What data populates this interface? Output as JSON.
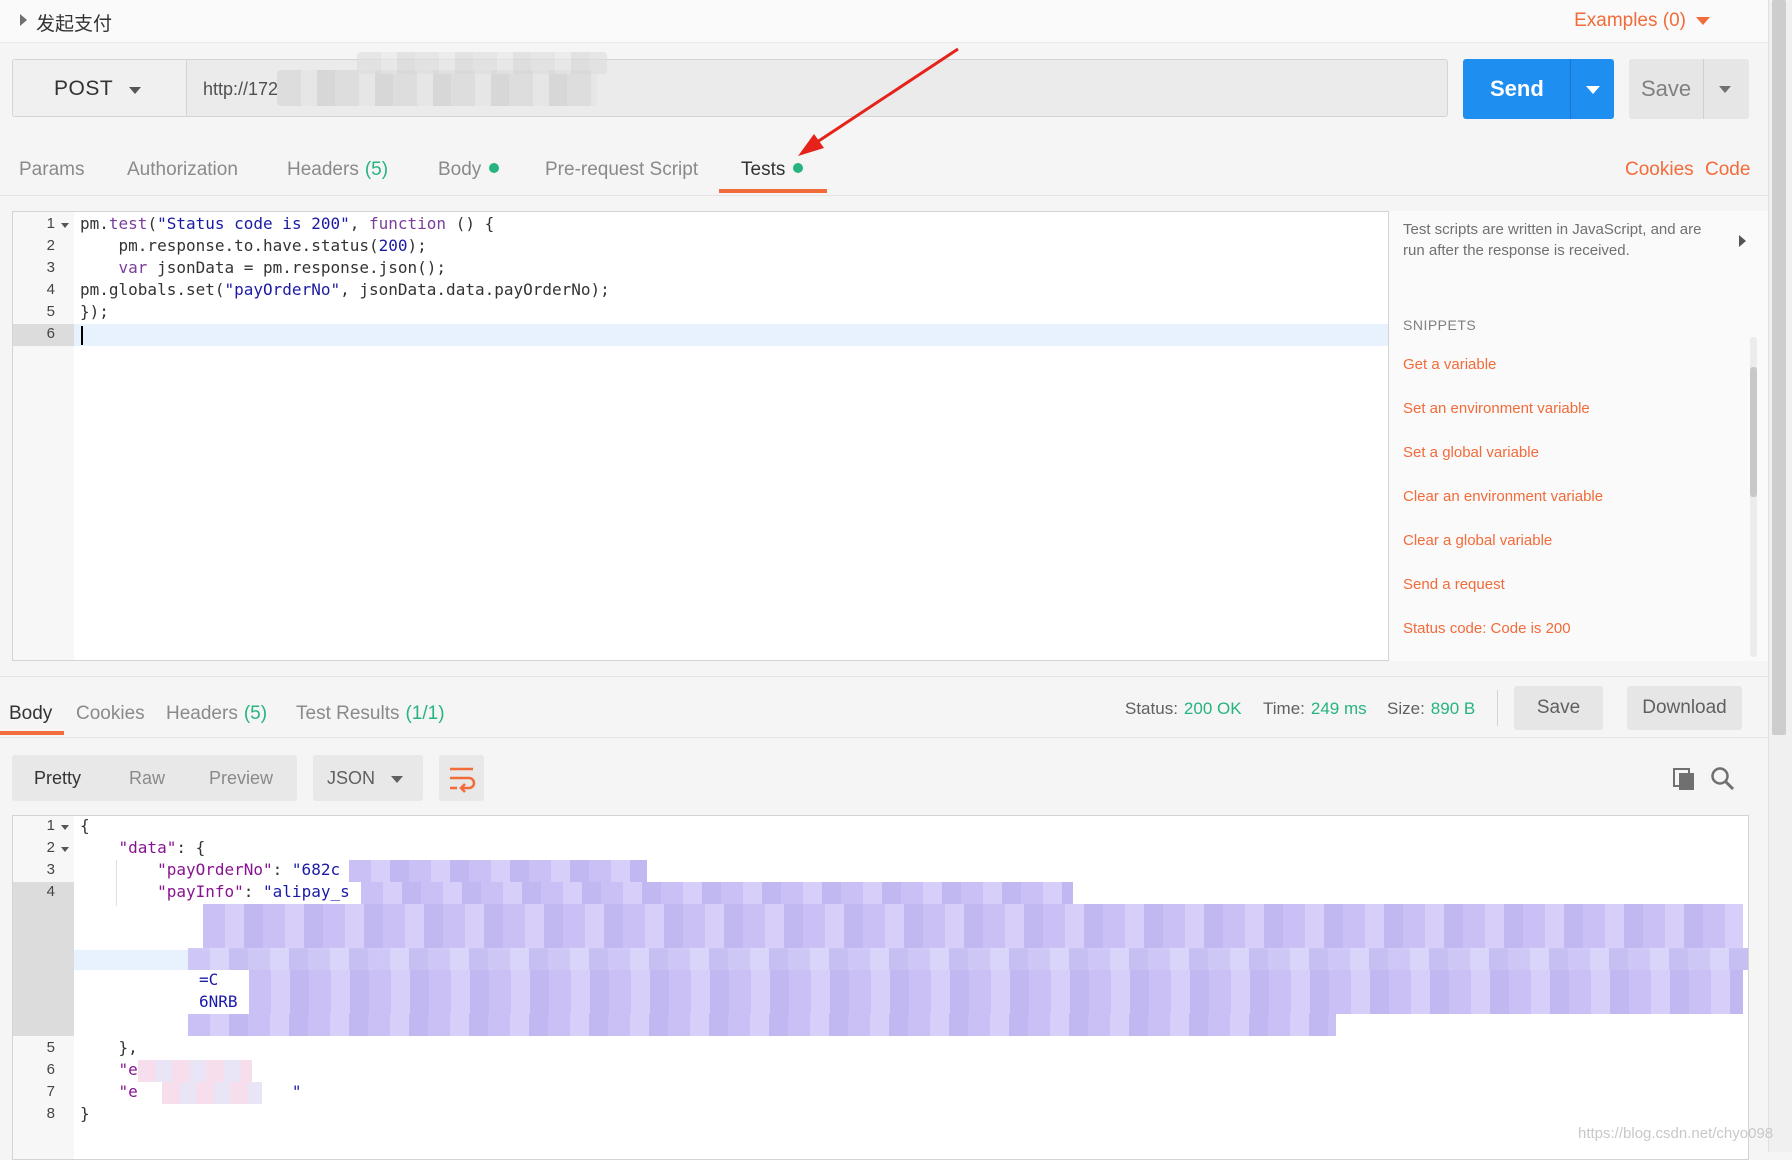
{
  "request": {
    "name": "发起支付",
    "examples_label": "Examples (0)",
    "method": "POST",
    "url_visible": "http://172",
    "send_label": "Send",
    "save_label": "Save"
  },
  "request_tabs": [
    {
      "label": "Params",
      "count": ""
    },
    {
      "label": "Authorization",
      "count": ""
    },
    {
      "label": "Headers",
      "count": "(5)"
    },
    {
      "label": "Body",
      "count": ""
    },
    {
      "label": "Pre-request Script",
      "count": ""
    },
    {
      "label": "Tests",
      "count": ""
    }
  ],
  "right_links": {
    "cookies": "Cookies",
    "code": "Code"
  },
  "editor": {
    "line_numbers": [
      "1",
      "2",
      "3",
      "4",
      "5",
      "6"
    ]
  },
  "snippets": {
    "description": "Test scripts are written in JavaScript, and are run after the response is received.",
    "header": "SNIPPETS",
    "items": [
      "Get a variable",
      "Set an environment variable",
      "Set a global variable",
      "Clear an environment variable",
      "Clear a global variable",
      "Send a request",
      "Status code: Code is 200"
    ]
  },
  "response": {
    "tabs": [
      {
        "label": "Body",
        "count": ""
      },
      {
        "label": "Cookies",
        "count": ""
      },
      {
        "label": "Headers",
        "count": "(5)"
      },
      {
        "label": "Test Results",
        "count": "(1/1)"
      }
    ],
    "status_label": "Status:",
    "status_value": "200 OK",
    "time_label": "Time:",
    "time_value": "249 ms",
    "size_label": "Size:",
    "size_value": "890 B",
    "save_label": "Save",
    "download_label": "Download",
    "formats": [
      "Pretty",
      "Raw",
      "Preview"
    ],
    "language": "JSON",
    "line_numbers": [
      "1",
      "2",
      "3",
      "4",
      "5",
      "6",
      "7",
      "8"
    ]
  },
  "watermark": "https://blog.csdn.net/chyo098",
  "colors": {
    "accent": "#f26b3a",
    "send": "#1e8ef1",
    "success": "#26b47f"
  }
}
